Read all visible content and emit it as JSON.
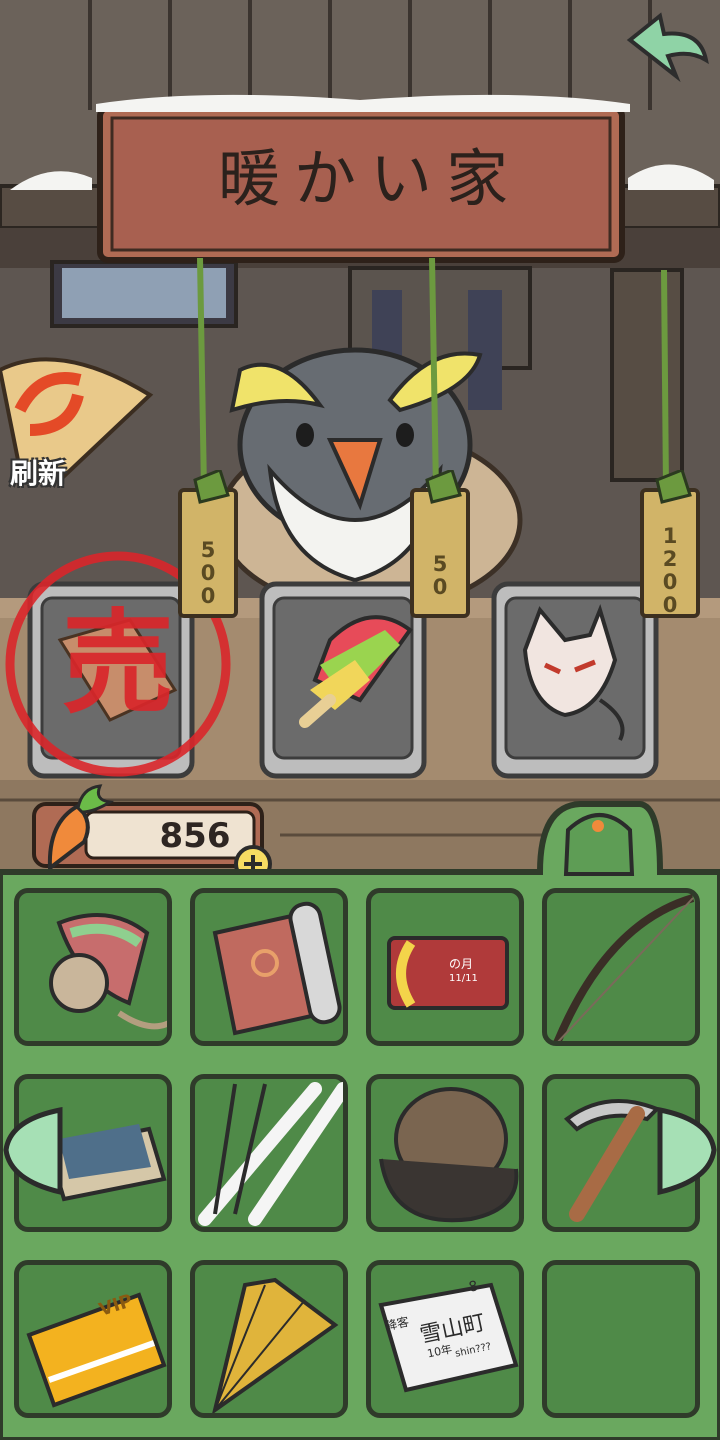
{
  "shop": {
    "sign_title": "暖かい家",
    "refresh_label": "刷新",
    "items": [
      {
        "price": "500",
        "status": "sold",
        "sold_stamp": "売",
        "item": "paper-fan-item"
      },
      {
        "price": "50",
        "status": "available",
        "item": "popsicle-item"
      },
      {
        "price": "1200",
        "status": "available",
        "item": "fox-mask-item"
      }
    ]
  },
  "wallet": {
    "currency_icon": "carrot-icon",
    "amount": "856"
  },
  "inventory": {
    "icon": "backpack-icon",
    "slots": [
      {
        "item": "spinning-top-item"
      },
      {
        "item": "rolled-mat-item"
      },
      {
        "item": "playing-card-item",
        "label_text": "の月",
        "label_text2": "11/11"
      },
      {
        "item": "bow-item"
      },
      {
        "item": "matchbox-item"
      },
      {
        "item": "ski-set-item"
      },
      {
        "item": "fur-hat-item"
      },
      {
        "item": "ice-axe-item"
      },
      {
        "item": "vip-card-item",
        "label_text": "VIP"
      },
      {
        "item": "folding-fan-item"
      },
      {
        "item": "train-ticket-item",
        "label_text": "雪山町",
        "label_text2": "降客",
        "label_text3": "8",
        "label_text4": "10年",
        "label_text5": "shin???"
      },
      {
        "item": "empty"
      }
    ]
  },
  "colors": {
    "inventory_bg": "#6aa85f",
    "slot_bg": "#4f8a48",
    "sign_wood": "#a0614a",
    "sold_red": "#d9262a"
  }
}
